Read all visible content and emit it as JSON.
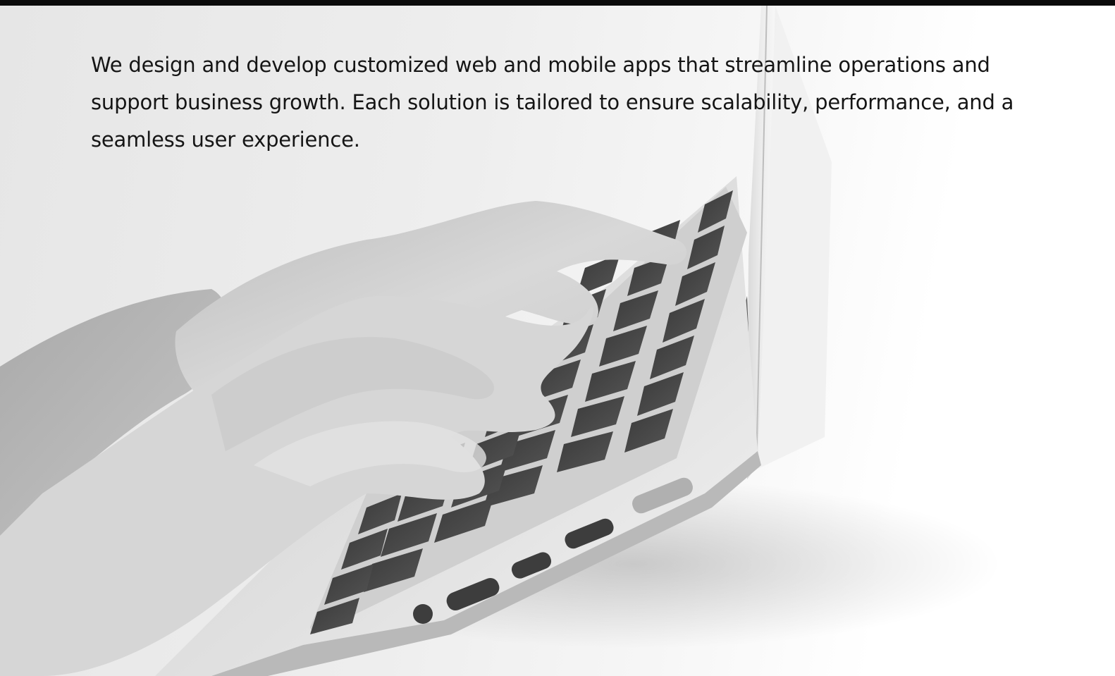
{
  "hero": {
    "intro_text": "We design and develop customized web and mobile apps that streamline operations and support business growth. Each solution is tailored to ensure scalability, performance, and a seamless user experience.",
    "image_subject": "hands-typing-on-laptop",
    "tone": "grayscale"
  },
  "colors": {
    "top_bar": "#0b0b0b",
    "text": "#151515",
    "background": "#ffffff"
  }
}
